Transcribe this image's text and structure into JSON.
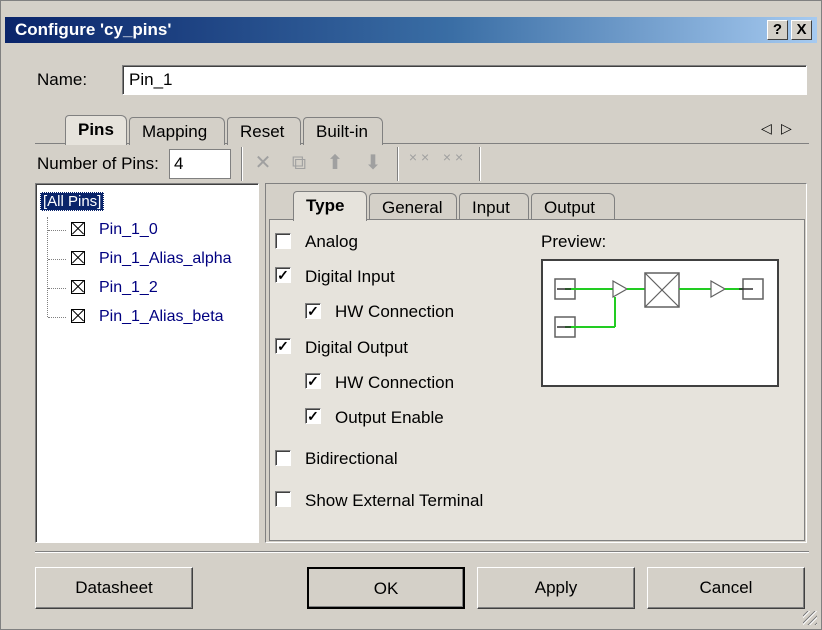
{
  "window": {
    "title": "Configure 'cy_pins'",
    "help_label": "?",
    "close_label": "X"
  },
  "name": {
    "label": "Name:",
    "value": "Pin_1"
  },
  "tabs": [
    {
      "label": "Pins"
    },
    {
      "label": "Mapping"
    },
    {
      "label": "Reset"
    },
    {
      "label": "Built-in"
    }
  ],
  "tab_scroll": {
    "left": "◁",
    "right": "▷"
  },
  "toolbar": {
    "num_pins_label": "Number of Pins:",
    "num_pins_value": "4"
  },
  "tree": {
    "root": "[All Pins]",
    "items": [
      {
        "label": "Pin_1_0"
      },
      {
        "label": "Pin_1_Alias_alpha"
      },
      {
        "label": "Pin_1_2"
      },
      {
        "label": "Pin_1_Alias_beta"
      }
    ]
  },
  "subtabs": [
    {
      "label": "Type"
    },
    {
      "label": "General"
    },
    {
      "label": "Input"
    },
    {
      "label": "Output"
    }
  ],
  "options": {
    "analog": {
      "label": "Analog",
      "checked": false
    },
    "digital_input": {
      "label": "Digital Input",
      "checked": true
    },
    "hw_connection_in": {
      "label": "HW Connection",
      "checked": true
    },
    "digital_output": {
      "label": "Digital Output",
      "checked": true
    },
    "hw_connection_out": {
      "label": "HW Connection",
      "checked": true
    },
    "output_enable": {
      "label": "Output Enable",
      "checked": true
    },
    "bidirectional": {
      "label": "Bidirectional",
      "checked": false
    },
    "show_external": {
      "label": "Show External Terminal",
      "checked": false
    }
  },
  "preview": {
    "label": "Preview:"
  },
  "buttons": {
    "datasheet": "Datasheet",
    "ok": "OK",
    "apply": "Apply",
    "cancel": "Cancel"
  },
  "colors": {
    "title_start": "#0a246a",
    "title_end": "#a6caf0",
    "wire": "#22cc22",
    "dialog_bg": "#d4d0c8"
  }
}
